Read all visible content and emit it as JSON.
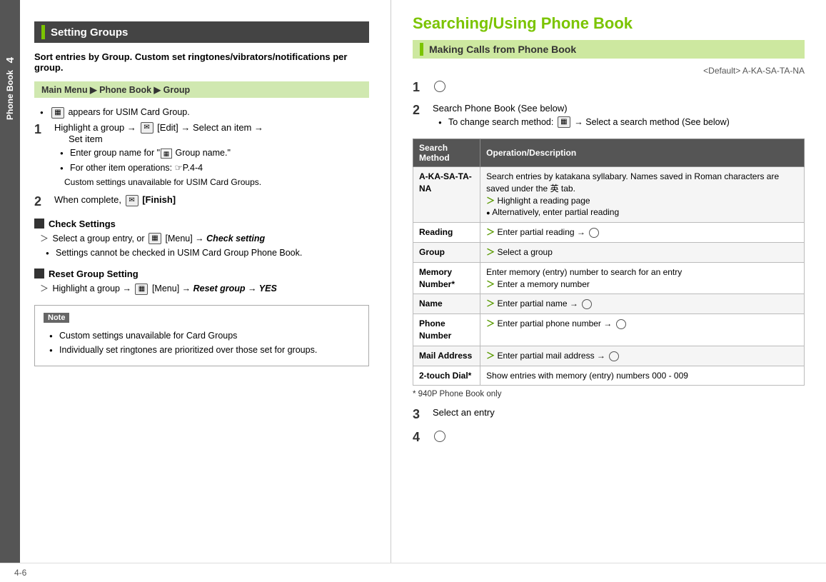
{
  "left": {
    "section_title": "Setting Groups",
    "intro": "Sort entries by Group. Custom set ringtones/vibrators/notifications per group.",
    "breadcrumb": "Main Menu ▶ Phone Book ▶ Group",
    "usim_note": "appears for USIM Card Group.",
    "step1_text": "[Edit] → Select an item →",
    "step1_continued": "Set item",
    "step1_highlight": "Highlight a group →",
    "step1_bullets": [
      "Enter group name for \"  Group name.\"",
      "For other item operations: ☞P.4-4"
    ],
    "step1_sub": "Custom settings unavailable for USIM Card Groups.",
    "step2_text": "When complete,",
    "step2_finish": "[Finish]",
    "check_settings_title": "Check Settings",
    "check_settings_line1": "Select a group entry, or",
    "check_settings_line1b": "[Menu] →",
    "check_settings_italic": "Check setting",
    "check_settings_line2": "Settings cannot be checked in USIM Card Group Phone Book.",
    "reset_title": "Reset Group Setting",
    "reset_line": "Highlight a group →",
    "reset_menu": "[Menu] →",
    "reset_italic": "Reset group → YES",
    "note_label": "Note",
    "note_bullets": [
      "Custom settings unavailable for Card Groups",
      "Individually set ringtones are prioritized over those set for groups."
    ]
  },
  "right": {
    "main_title": "Searching/Using Phone Book",
    "sub_title": "Making Calls from Phone Book",
    "default_label": "<Default> A-KA-SA-TA-NA",
    "step1_icon": true,
    "step2_label": "Search Phone Book (See below)",
    "step2_bullet": "To change search method:",
    "step2_arrow": "→ Select a search method (See below)",
    "table": {
      "headers": [
        "Search Method",
        "Operation/Description"
      ],
      "rows": [
        {
          "method": "A-KA-SA-TA-NA",
          "desc": "Search entries by katakana syllabary. Names saved in Roman characters are saved under the 英 tab.",
          "desc2": "> Highlight a reading page",
          "desc3": "● Alternatively, enter partial reading"
        },
        {
          "method": "Reading",
          "desc": "> Enter partial reading →",
          "has_icon": true
        },
        {
          "method": "Group",
          "desc": "> Select a group"
        },
        {
          "method": "Memory Number*",
          "desc": "Enter memory (entry) number to search for an entry",
          "desc2": "> Enter a memory number"
        },
        {
          "method": "Name",
          "desc": "> Enter partial name →",
          "has_icon": true
        },
        {
          "method": "Phone Number",
          "desc": "> Enter partial phone number →",
          "has_icon": true
        },
        {
          "method": "Mail Address",
          "desc": "> Enter partial mail address →",
          "has_icon": true
        },
        {
          "method": "2-touch Dial*",
          "desc": "Show entries with memory (entry) numbers 000 - 009"
        }
      ]
    },
    "footnote": "* 940P Phone Book only",
    "step3_label": "Select an entry",
    "step4_icon": true
  },
  "sidebar": {
    "number": "4",
    "label": "Phone Book"
  },
  "footer": {
    "page": "4-6"
  }
}
